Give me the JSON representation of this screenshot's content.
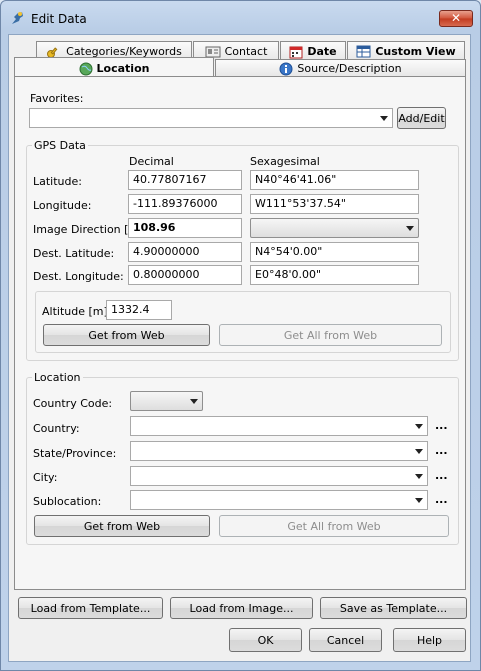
{
  "window": {
    "title": "Edit Data"
  },
  "tabs": {
    "row1": [
      {
        "label": "Categories/Keywords",
        "icon": "key-icon"
      },
      {
        "label": "Contact",
        "icon": "contact-card-icon"
      },
      {
        "label": "Date",
        "icon": "calendar-icon"
      },
      {
        "label": "Custom View",
        "icon": "custom-view-icon"
      }
    ],
    "row2": [
      {
        "label": "Location",
        "icon": "globe-icon",
        "active": true
      },
      {
        "label": "Source/Description",
        "icon": "info-icon"
      }
    ]
  },
  "favorites": {
    "label": "Favorites:",
    "value": "",
    "add_edit": "Add/Edit"
  },
  "gps": {
    "title": "GPS Data",
    "col_decimal": "Decimal",
    "col_sexagesimal": "Sexagesimal",
    "latitude": {
      "label": "Latitude:",
      "decimal": "40.77807167",
      "sexagesimal": "N40°46'41.06\""
    },
    "longitude": {
      "label": "Longitude:",
      "decimal": "-111.89376000",
      "sexagesimal": "W111°53'37.54\""
    },
    "direction": {
      "label": "Image Direction [°]:",
      "decimal": "108.96",
      "sexagesimal": ""
    },
    "dest_latitude": {
      "label": "Dest. Latitude:",
      "decimal": "4.90000000",
      "sexagesimal": "N4°54'0.00\""
    },
    "dest_longitude": {
      "label": "Dest. Longitude:",
      "decimal": "0.80000000",
      "sexagesimal": "E0°48'0.00\""
    },
    "altitude": {
      "label": "Altitude [m]:",
      "value": "1332.4"
    },
    "get_from_web": "Get from Web",
    "get_all_from_web": "Get All from Web"
  },
  "location": {
    "title": "Location",
    "country_code": {
      "label": "Country Code:",
      "value": ""
    },
    "country": {
      "label": "Country:",
      "value": ""
    },
    "state": {
      "label": "State/Province:",
      "value": ""
    },
    "city": {
      "label": "City:",
      "value": ""
    },
    "sublocation": {
      "label": "Sublocation:",
      "value": ""
    },
    "ellipsis": "...",
    "get_from_web": "Get from Web",
    "get_all_from_web": "Get All from Web"
  },
  "footer": {
    "load_template": "Load from Template...",
    "load_image": "Load from Image...",
    "save_template": "Save as Template...",
    "ok": "OK",
    "cancel": "Cancel",
    "help": "Help"
  }
}
